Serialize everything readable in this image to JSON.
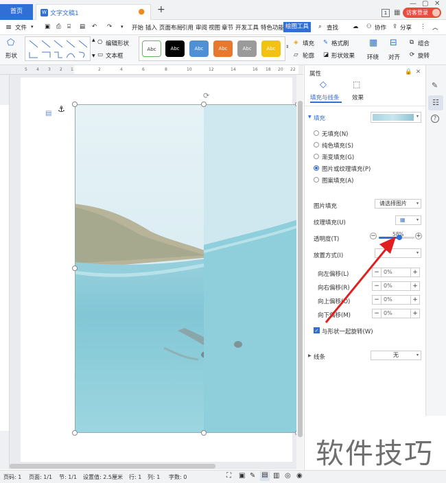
{
  "titlebar": {
    "home_tab": "首页",
    "doc_tab": "文字文稿1",
    "new_tab": "+",
    "badge": "1",
    "guest_login": "访客登录"
  },
  "menubar": {
    "file": "文件",
    "items": [
      "开始",
      "插入",
      "页面布局",
      "引用",
      "审阅",
      "视图",
      "章节",
      "开发工具",
      "特色功能"
    ],
    "active_tab": "绘图工具",
    "search": "查找",
    "collab": "协作",
    "share": "分享"
  },
  "ribbon": {
    "shape_label": "形状",
    "edit_shape": "编辑形状",
    "text_box": "文本框",
    "style_label": "Abc",
    "fill": "填充",
    "format_brush": "格式刷",
    "outline": "轮廓",
    "shape_effect": "形状效果",
    "wrap": "环绕",
    "align": "对齐",
    "group": "组合",
    "rotate": "旋转"
  },
  "ruler": {
    "numbers": [
      "5",
      "4",
      "3",
      "2",
      "1",
      "2",
      "4",
      "6",
      "8",
      "10",
      "12",
      "14",
      "16",
      "18",
      "20",
      "22"
    ]
  },
  "panel": {
    "title": "属性",
    "tab_fill_line": "填充与线条",
    "tab_effect": "效果",
    "section_fill": "填充",
    "fill_options": [
      "无填充(N)",
      "纯色填充(S)",
      "渐变填充(G)",
      "图片或纹理填充(P)",
      "图案填充(A)"
    ],
    "selected_fill": "图片或纹理填充(P)",
    "picture_fill_label": "图片填充",
    "picture_fill_value": "请选择图片",
    "texture_fill_label": "纹理填充(U)",
    "transparency_label": "透明度(T)",
    "transparency_value": "58%",
    "transparency": 0.58,
    "placement_label": "放置方式(I)",
    "offsets": [
      {
        "label": "向左偏移(L)",
        "value": "0%"
      },
      {
        "label": "向右偏移(R)",
        "value": "0%"
      },
      {
        "label": "向上偏移(O)",
        "value": "0%"
      },
      {
        "label": "向下偏移(M)",
        "value": "0%"
      }
    ],
    "rotate_with_shape": "与形状一起旋转(W)",
    "section_line": "线条",
    "line_value": "无"
  },
  "status": {
    "page_num": "页码: 1",
    "page": "页面: 1/1",
    "section": "节: 1/1",
    "setting": "设置值: 2.5厘米",
    "row": "行: 1",
    "col": "列: 1",
    "chars": "字数: 0"
  },
  "watermark": "软件技巧",
  "colors": {
    "accent": "#2f6fd6",
    "guest": "#e84c3d",
    "arrow": "#e02020"
  }
}
